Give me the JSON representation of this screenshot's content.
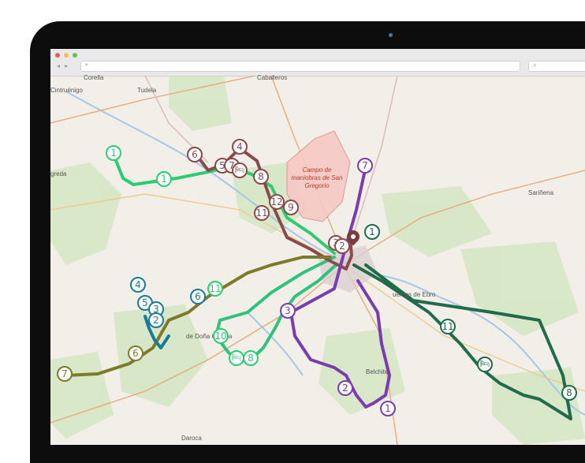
{
  "browser": {
    "address_placeholder": "+",
    "search_glyph": "⌕",
    "nav_glyphs": "◂ ▸",
    "window_dots": [
      "#ee5c55",
      "#f5be4f",
      "#5fc750"
    ]
  },
  "map": {
    "places": [
      {
        "name": "Corella"
      },
      {
        "name": "Cintruénigo"
      },
      {
        "name": "Tudela"
      },
      {
        "name": "Caballeros"
      },
      {
        "name": "greda"
      },
      {
        "name": "Sariñena"
      },
      {
        "name": "de Doña Godina"
      },
      {
        "name": "Belchite"
      },
      {
        "name": "Daroca"
      },
      {
        "name": "uentes de Ebro"
      }
    ],
    "restricted_area": {
      "name": "Campo de maniobras de San Gregorio"
    },
    "routes": [
      {
        "id": "light-green",
        "color": "#2ecc71"
      },
      {
        "id": "mint",
        "color": "#2ec27e"
      },
      {
        "id": "maroon",
        "color": "#8b4a4a"
      },
      {
        "id": "purple",
        "color": "#7a3db0"
      },
      {
        "id": "dark-green",
        "color": "#1f6b4a"
      },
      {
        "id": "olive",
        "color": "#7d7a2c"
      },
      {
        "id": "teal",
        "color": "#1a7a9a"
      }
    ],
    "markers": [
      {
        "label": "1",
        "color": "#2ecc71"
      },
      {
        "label": "1",
        "color": "#2ecc71"
      },
      {
        "label": "6",
        "color": "#8b4a4a"
      },
      {
        "label": "4",
        "color": "#8b4a4a"
      },
      {
        "label": "5",
        "color": "#8b4a4a"
      },
      {
        "label": "7",
        "color": "#8b4a4a"
      },
      {
        "label": "🛏",
        "color": "#8b4a4a"
      },
      {
        "label": "8",
        "color": "#8b4a4a"
      },
      {
        "label": "12",
        "color": "#8b4a4a"
      },
      {
        "label": "9",
        "color": "#8b4a4a"
      },
      {
        "label": "11",
        "color": "#8b4a4a"
      },
      {
        "label": "7",
        "color": "#7a3db0"
      },
      {
        "label": "1",
        "color": "#1f6b4a"
      },
      {
        "label": "3",
        "color": "#8b4a4a"
      },
      {
        "label": "2",
        "color": "#8b4a4a"
      },
      {
        "label": "4",
        "color": "#1a7a9a"
      },
      {
        "label": "5",
        "color": "#1a7a9a"
      },
      {
        "label": "3",
        "color": "#1a7a9a"
      },
      {
        "label": "2",
        "color": "#1a7a9a"
      },
      {
        "label": "6",
        "color": "#1a7a9a"
      },
      {
        "label": "11",
        "color": "#2ecc71"
      },
      {
        "label": "10",
        "color": "#2ecc71"
      },
      {
        "label": "🛏",
        "color": "#2ecc71"
      },
      {
        "label": "8",
        "color": "#2ecc71"
      },
      {
        "label": "3",
        "color": "#7a3db0"
      },
      {
        "label": "6",
        "color": "#7d7a2c"
      },
      {
        "label": "7",
        "color": "#7d7a2c"
      },
      {
        "label": "11",
        "color": "#1f6b4a"
      },
      {
        "label": "🛏",
        "color": "#1f6b4a"
      },
      {
        "label": "8",
        "color": "#1f6b4a"
      },
      {
        "label": "2",
        "color": "#7a3db0"
      },
      {
        "label": "1",
        "color": "#7a3db0"
      }
    ]
  }
}
